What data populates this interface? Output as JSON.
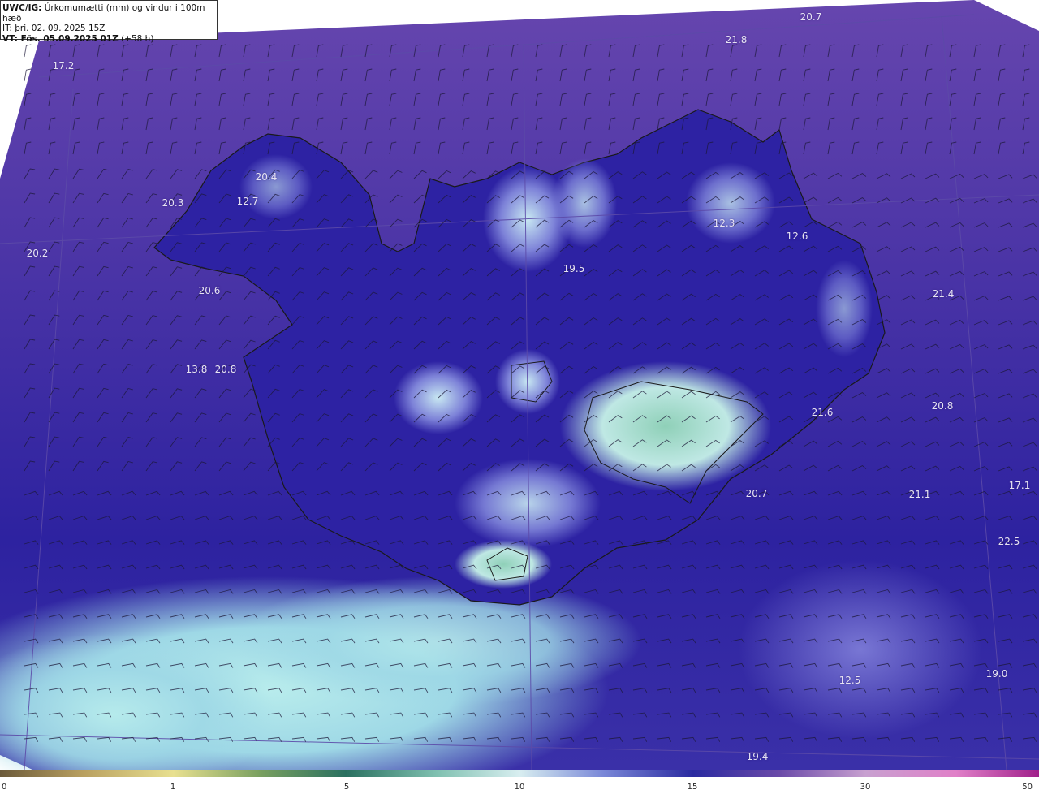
{
  "header": {
    "title_prefix": "UWC/IG:",
    "title_text": " Úrkomumætti (mm) og vindur i 100m hæð",
    "it_line": "IT: þri. 02. 09. 2025 15Z",
    "vt_bold": "VT: Fös. 05.09.2025 01Z",
    "vt_extra": " (+58 h)"
  },
  "colors": {
    "ocean_base": "#3a2aa0",
    "ocean_north": "#5a3ea8",
    "land_base": "#2a1f9c",
    "high_values": "#aee6e8",
    "peak_values": "#6fbfa8",
    "coastline": "#1a1a1a",
    "barbs": "#1a1a2e"
  },
  "value_labels": [
    {
      "text": "20.7",
      "lon": 999,
      "lat": 21
    },
    {
      "text": "21.8",
      "lon": 907,
      "lat": 49
    },
    {
      "text": "17.2",
      "lon": 78,
      "lat": 81
    },
    {
      "text": "20.4",
      "lon": 328,
      "lat": 218
    },
    {
      "text": "20.3",
      "lon": 213,
      "lat": 250
    },
    {
      "text": "12.7",
      "lon": 305,
      "lat": 248
    },
    {
      "text": "12.3",
      "lon": 892,
      "lat": 275
    },
    {
      "text": "12.6",
      "lon": 982,
      "lat": 291
    },
    {
      "text": "20.2",
      "lon": 46,
      "lat": 312
    },
    {
      "text": "19.5",
      "lon": 707,
      "lat": 331
    },
    {
      "text": "20.6",
      "lon": 258,
      "lat": 358
    },
    {
      "text": "21.4",
      "lon": 1162,
      "lat": 362
    },
    {
      "text": "13.8",
      "lon": 242,
      "lat": 455
    },
    {
      "text": "20.8",
      "lon": 278,
      "lat": 455
    },
    {
      "text": "20.8",
      "lon": 1161,
      "lat": 500
    },
    {
      "text": "21.6",
      "lon": 1013,
      "lat": 508
    },
    {
      "text": "20.7",
      "lon": 932,
      "lat": 608
    },
    {
      "text": "21.1",
      "lon": 1133,
      "lat": 609
    },
    {
      "text": "17.1",
      "lon": 1256,
      "lat": 598
    },
    {
      "text": "22.5",
      "lon": 1243,
      "lat": 667
    },
    {
      "text": "12.5",
      "lon": 1047,
      "lat": 838
    },
    {
      "text": "19.0",
      "lon": 1228,
      "lat": 830
    },
    {
      "text": "19.4",
      "lon": 933,
      "lat": 932
    }
  ],
  "colorbar": {
    "ticks": [
      "0",
      "1",
      "5",
      "10",
      "15",
      "30",
      "50"
    ]
  }
}
